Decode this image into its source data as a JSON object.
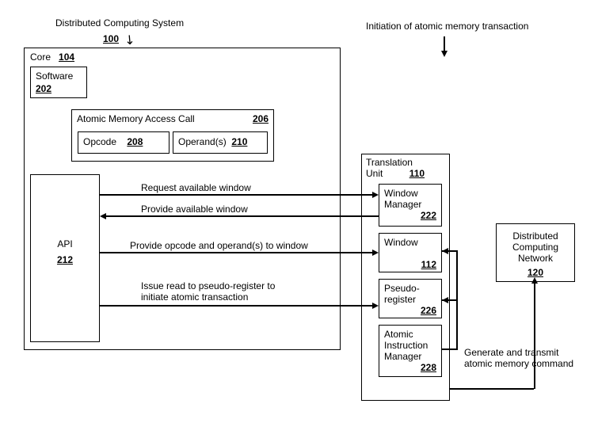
{
  "system": {
    "label": "Distributed Computing System",
    "ref": "100"
  },
  "core": {
    "label": "Core",
    "ref": "104"
  },
  "software": {
    "label": "Software",
    "ref": "202"
  },
  "amac": {
    "label": "Atomic Memory Access Call",
    "ref": "206",
    "opcode": {
      "label": "Opcode",
      "ref": "208"
    },
    "operands": {
      "label": "Operand(s)",
      "ref": "210"
    }
  },
  "api": {
    "label": "API",
    "ref": "212"
  },
  "tu": {
    "label": "Translation\nUnit",
    "ref": "110"
  },
  "wm": {
    "label": "Window\nManager",
    "ref": "222"
  },
  "window": {
    "label": "Window",
    "ref": "112"
  },
  "pr": {
    "label": "Pseudo-\nregister",
    "ref": "226"
  },
  "aim": {
    "label": "Atomic\nInstruction\nManager",
    "ref": "228"
  },
  "dcn": {
    "label": "Distributed\nComputing\nNetwork",
    "ref": "120"
  },
  "msg": {
    "req": "Request available window",
    "prov": "Provide available window",
    "provop": "Provide opcode and operand(s) to window",
    "issue": "Issue read to pseudo-register to\ninitiate atomic transaction",
    "init": "Initiation of atomic memory transaction",
    "gen": "Generate and transmit\natomic memory command"
  }
}
